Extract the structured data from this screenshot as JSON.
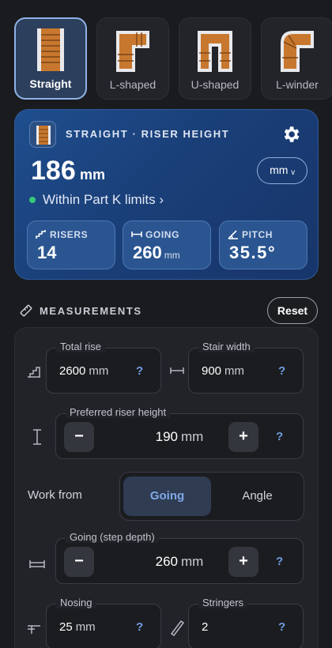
{
  "stair_types": [
    {
      "label": "Straight",
      "icon": "straight-stair-icon",
      "selected": true
    },
    {
      "label": "L-shaped",
      "icon": "l-shaped-stair-icon",
      "selected": false
    },
    {
      "label": "U-shaped",
      "icon": "u-shaped-stair-icon",
      "selected": false
    },
    {
      "label": "L-winder",
      "icon": "l-winder-stair-icon",
      "selected": false
    }
  ],
  "result": {
    "title": "STRAIGHT · RISER HEIGHT",
    "value": "186",
    "unit": "mm",
    "unit_toggle": "mm ᵥ",
    "status": "Within Part K limits ›",
    "status_color": "#37c976",
    "stats": [
      {
        "label": "RISERS",
        "value": "14",
        "unit": ""
      },
      {
        "label": "GOING",
        "value": "260",
        "unit": "mm"
      },
      {
        "label": "PITCH",
        "value": "35.5°",
        "unit": ""
      }
    ]
  },
  "measurements": {
    "title": "MEASUREMENTS",
    "reset_label": "Reset",
    "total_rise": {
      "label": "Total rise",
      "value": "2600",
      "unit": "mm",
      "help": "?"
    },
    "stair_width": {
      "label": "Stair width",
      "value": "900",
      "unit": "mm",
      "help": "?"
    },
    "riser_height": {
      "label": "Preferred riser height",
      "value": "190",
      "unit": "mm",
      "minus": "−",
      "plus": "+",
      "help": "?"
    },
    "work_from": {
      "label": "Work from",
      "options": [
        "Going",
        "Angle"
      ],
      "selected": "Going"
    },
    "going": {
      "label": "Going (step depth)",
      "value": "260",
      "unit": "mm",
      "minus": "−",
      "plus": "+",
      "help": "?"
    },
    "nosing": {
      "label": "Nosing",
      "value": "25",
      "unit": "mm",
      "help": "?"
    },
    "stringers": {
      "label": "Stringers",
      "value": "2",
      "help": "?"
    }
  },
  "colors": {
    "accent": "#8fb3e6",
    "card_bg": "#1f4e8e",
    "help": "#6f9de0"
  }
}
